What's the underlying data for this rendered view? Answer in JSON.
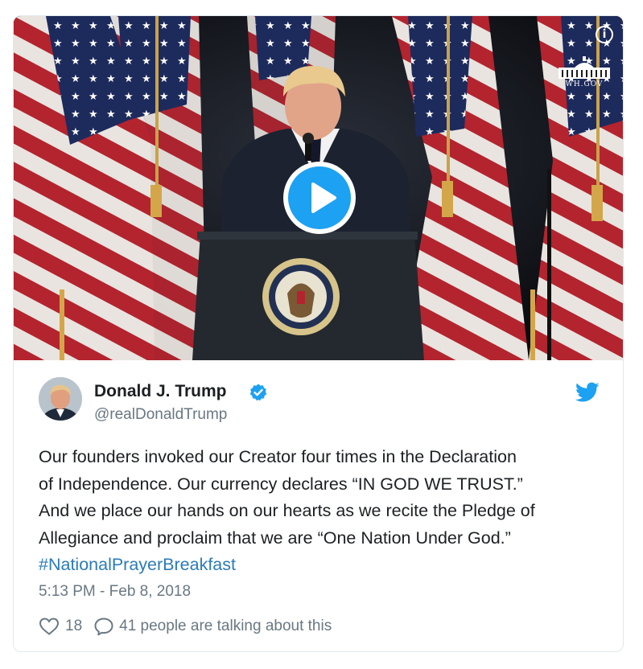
{
  "tweet": {
    "author_name": "Donald J. Trump",
    "handle": "@realDonaldTrump",
    "text_lines": [
      "Our founders invoked our Creator four times in the Declaration",
      "of Independence. Our currency declares “IN GOD WE TRUST.”",
      "And we place our hands on our hearts as we recite the Pledge of",
      "Allegiance and proclaim that we are “One Nation Under God.”"
    ],
    "hashtag": "#NationalPrayerBreakfast",
    "timestamp": "5:13 PM - Feb 8, 2018",
    "like_count": "18",
    "talking_text": "41 people are talking about this"
  },
  "media": {
    "watermark": "WH.GOV",
    "info_icon": "i",
    "play_icon": "play-icon"
  },
  "colors": {
    "accent": "#1da1f2",
    "link": "#2b7bb9",
    "secondary_text": "#697882",
    "primary_text": "#1c2022",
    "border": "#e1e8ed"
  }
}
